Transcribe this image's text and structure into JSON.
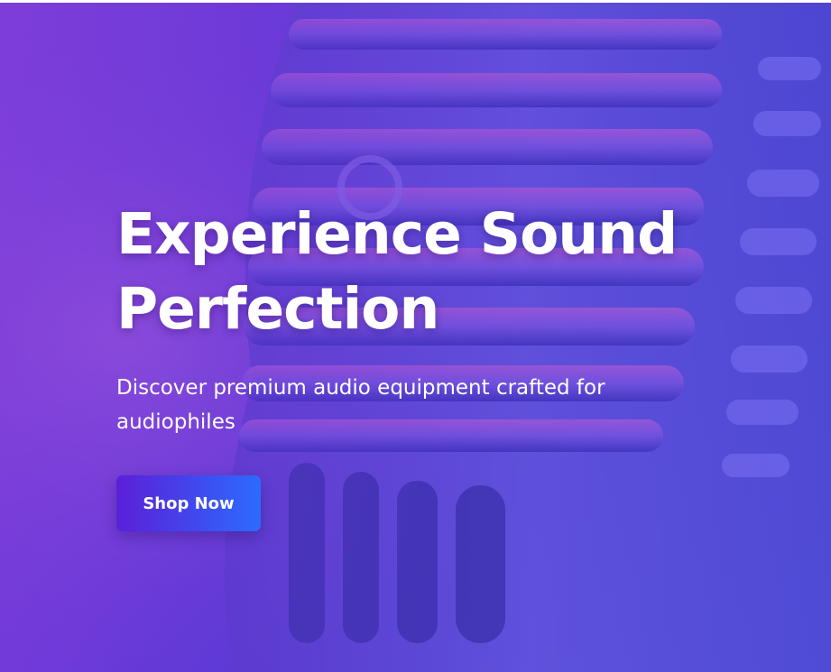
{
  "hero": {
    "title": "Experience Sound Perfection",
    "subtitle": "Discover premium audio equipment crafted for audiophiles",
    "cta_label": "Shop Now",
    "background_image": "vintage-microphone"
  },
  "colors": {
    "gradient_purple": "#7a3fd6",
    "gradient_blue": "#4a3cd0",
    "button_start": "#5b1fd8",
    "button_end": "#2c6bff",
    "text": "#ffffff"
  }
}
